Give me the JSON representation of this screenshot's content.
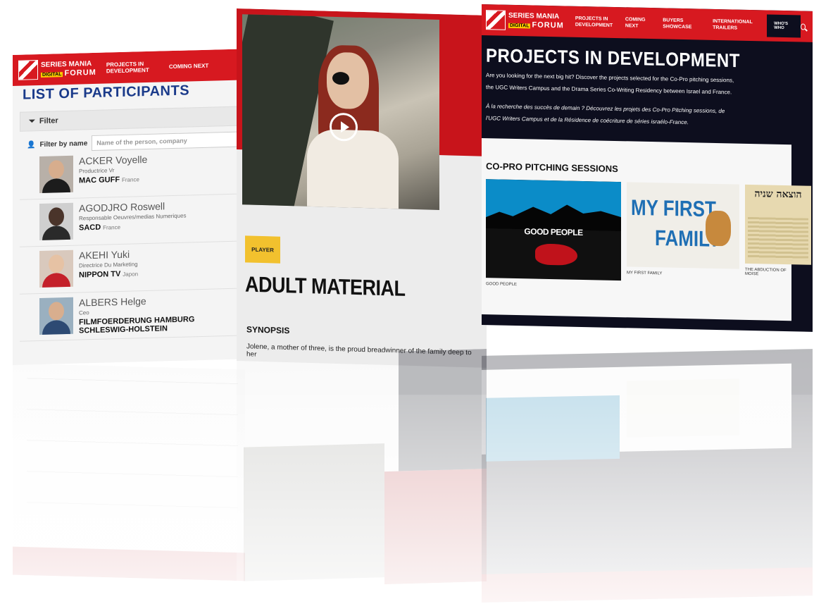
{
  "brand": {
    "series": "SERIES MANIA",
    "digital": "DIGITAL",
    "forum": "FORUM"
  },
  "left_page": {
    "nav": [
      "PROJECTS IN DEVELOPMENT",
      "COMING NEXT"
    ],
    "title": "LIST OF PARTICIPANTS",
    "filter_label": "Filter",
    "filter_by_name_label": "Filter by name",
    "search_placeholder": "Name of the person, company",
    "people": [
      {
        "name": "ACKER Voyelle",
        "role": "Productrice Vr",
        "company": "MAC GUFF",
        "country": "France"
      },
      {
        "name": "AGODJRO Roswell",
        "role": "Responsable Oeuvres/medias Numeriques",
        "company": "SACD",
        "country": "France"
      },
      {
        "name": "AKEHI Yuki",
        "role": "Directrice Du Marketing",
        "company": "NIPPON TV",
        "country": "Japon"
      },
      {
        "name": "ALBERS Helge",
        "role": "Ceo",
        "company": "FILMFOERDERUNG HAMBURG SCHLESWIG-HOLSTEIN",
        "country": ""
      }
    ]
  },
  "middle_page": {
    "tag": "PLAYER",
    "title": "ADULT MATERIAL",
    "synopsis_label": "SYNOPSIS",
    "synopsis_text": "Jolene, a mother of three, is the proud breadwinner of the family deep to her"
  },
  "right_page": {
    "nav": [
      "PROJECTS IN DEVELOPMENT",
      "COMING NEXT",
      "BUYERS SHOWCASE",
      "INTERNATIONAL TRAILERS"
    ],
    "whos_who": "WHO'S WHO",
    "title": "PROJECTS IN DEVELOPMENT",
    "intro_en_1": "Are you looking for the next big hit? Discover the projects selected for the Co-Pro pitching sessions,",
    "intro_en_2": "the UGC Writers Campus and the Drama Series Co-Writing Residency between Israel and France.",
    "intro_fr_1": "À la recherche des succès de demain ? Découvrez les projets des Co-Pro Pitching sessions, de",
    "intro_fr_2": "l'UGC Writers Campus et de la Résidence de coécriture de séries israélo-France.",
    "section_title": "CO-PRO PITCHING SESSIONS",
    "cards": [
      {
        "art": "GOOD PEOPLE",
        "caption": "GOOD PEOPLE"
      },
      {
        "art_1": "MY FIRST",
        "art_2": "FAMILY",
        "caption": "MY FIRST FAMILY"
      },
      {
        "art": "הוצאה שניה",
        "caption": "THE ABDUCTION OF MOISE"
      }
    ]
  },
  "colors": {
    "brand_red": "#d71920",
    "navy": "#0d0e1e",
    "title_blue": "#1a3a8a",
    "tag_yellow": "#f2c12e"
  }
}
